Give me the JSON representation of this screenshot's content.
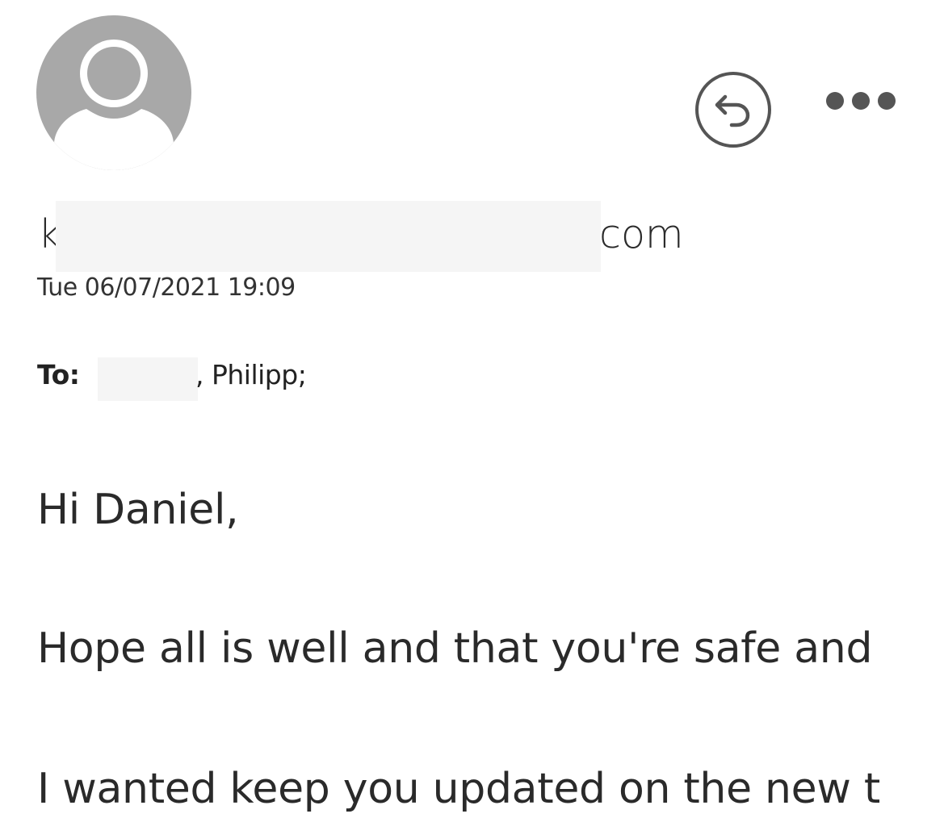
{
  "header": {
    "avatar_icon": "person-silhouette-icon",
    "reply_icon": "reply-arrow-icon",
    "more_icon": "ellipsis-icon"
  },
  "sender": {
    "prefix": "k",
    "suffix": "com",
    "redacted": true
  },
  "date": "Tue 06/07/2021 19:09",
  "to": {
    "label": "To:",
    "recipients_visible": ", Philipp;"
  },
  "body": {
    "lines": [
      "Hi Daniel,",
      "Hope all is well and that you're safe and",
      "I wanted keep you updated on the new t"
    ]
  },
  "colors": {
    "avatar_bg": "#a8a8a8",
    "text": "#262626",
    "redaction": "#f5f5f5",
    "icon": "#555555"
  }
}
